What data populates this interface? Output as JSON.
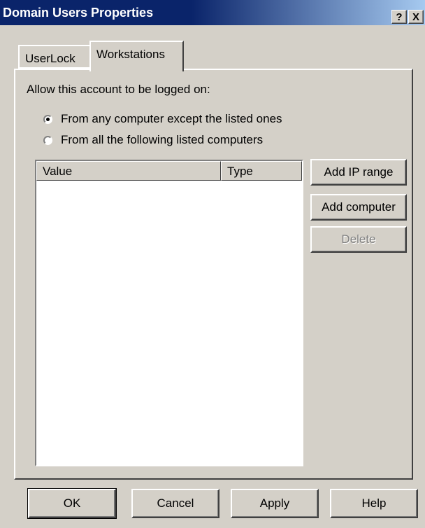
{
  "window": {
    "title": "Domain Users Properties",
    "help_button": "?",
    "close_button": "X"
  },
  "tabs": [
    {
      "label": "UserLock",
      "active": false
    },
    {
      "label": "Workstations",
      "active": true
    }
  ],
  "workstations": {
    "allow_label": "Allow this account to be logged on:",
    "options": [
      {
        "label": "From any computer except the listed ones",
        "selected": true
      },
      {
        "label": "From all the following listed computers",
        "selected": false
      }
    ],
    "list": {
      "columns": [
        "Value",
        "Type"
      ],
      "rows": []
    },
    "buttons": {
      "add_ip_range": "Add IP range",
      "add_computer": "Add computer",
      "delete": "Delete"
    }
  },
  "footer": {
    "ok": "OK",
    "cancel": "Cancel",
    "apply": "Apply",
    "help": "Help"
  },
  "colors": {
    "titlebar_start": "#0a246a",
    "titlebar_end": "#a6caf0",
    "face": "#d4d0c8"
  }
}
